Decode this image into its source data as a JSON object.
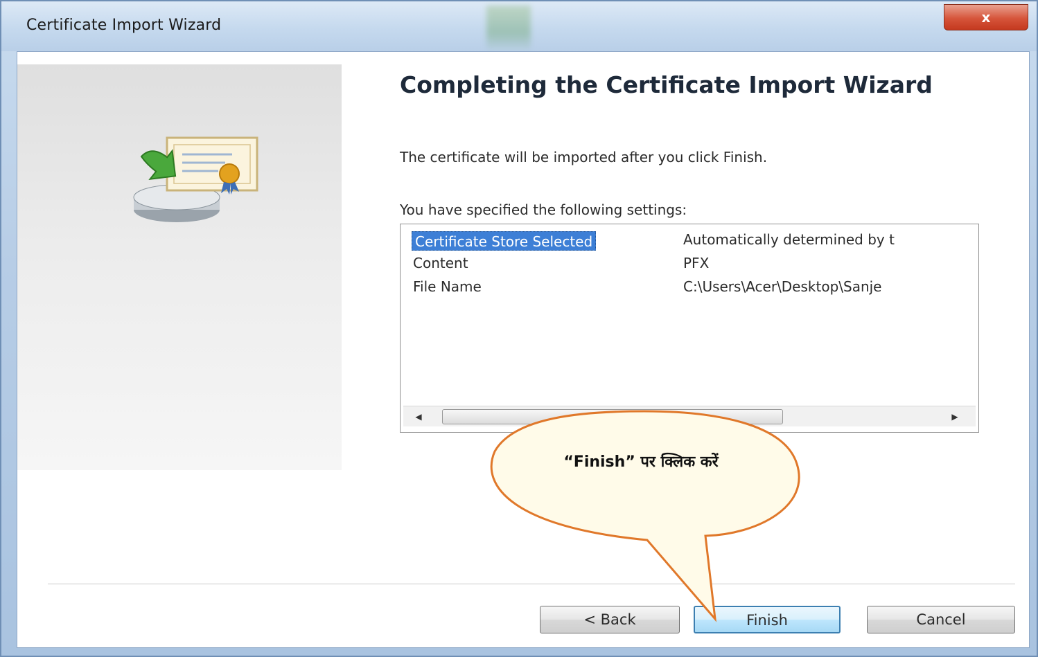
{
  "window": {
    "title": "Certificate Import Wizard",
    "close_glyph": "x"
  },
  "wizard": {
    "heading": "Completing the Certificate Import Wizard",
    "intro": "The certificate will be imported after you click Finish.",
    "settings_label": "You have specified the following settings:",
    "settings": [
      {
        "key": "Certificate Store Selected",
        "value": "Automatically determined by t"
      },
      {
        "key": "Content",
        "value": "PFX"
      },
      {
        "key": "File Name",
        "value": "C:\\Users\\Acer\\Desktop\\Sanje"
      }
    ],
    "scroll_grip": "III"
  },
  "buttons": {
    "back": "< Back",
    "finish": "Finish",
    "cancel": "Cancel"
  },
  "annotation": {
    "text": "“Finish” पर क्लिक करें"
  },
  "colors": {
    "selection": "#3d7fd6",
    "callout_border": "#e0782a",
    "finish_border": "#3c7fb1",
    "close_button": "#d6543a"
  }
}
